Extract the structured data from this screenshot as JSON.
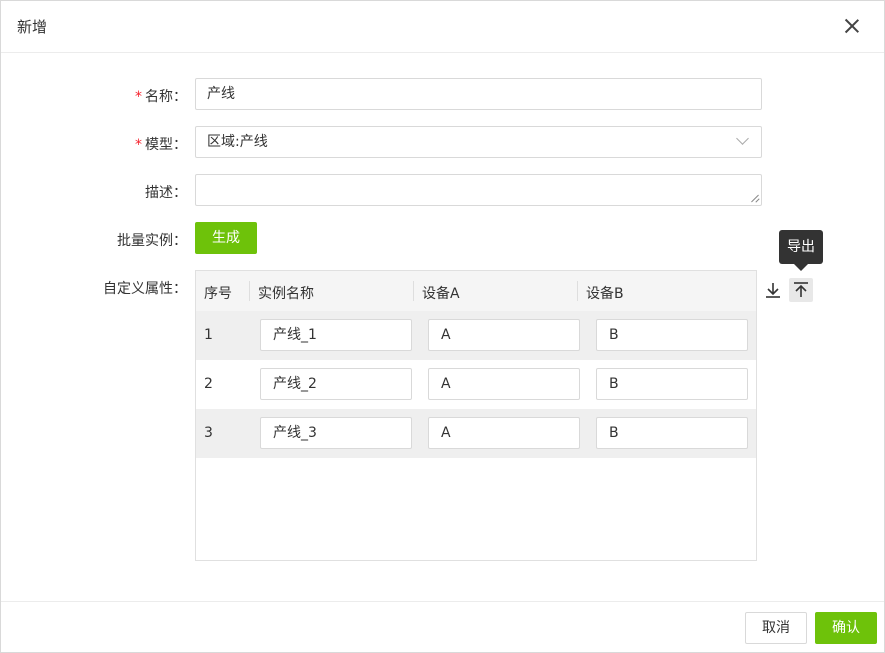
{
  "dialog": {
    "title": "新增"
  },
  "form": {
    "name": {
      "label": "名称：",
      "value": "产线"
    },
    "model": {
      "label": "模型：",
      "value": "区域:产线"
    },
    "desc": {
      "label": "描述：",
      "value": ""
    },
    "batch": {
      "label": "批量实例：",
      "button": "生成"
    },
    "custom": {
      "label": "自定义属性："
    }
  },
  "table": {
    "headers": [
      "序号",
      "实例名称",
      "设备A",
      "设备B"
    ],
    "rows": [
      {
        "index": "1",
        "name": "产线_1",
        "a": "A",
        "b": "B"
      },
      {
        "index": "2",
        "name": "产线_2",
        "a": "A",
        "b": "B"
      },
      {
        "index": "3",
        "name": "产线_3",
        "a": "A",
        "b": "B"
      }
    ]
  },
  "actions": {
    "import_icon": "download-icon",
    "export_icon": "upload-icon",
    "tooltip": "导出"
  },
  "footer": {
    "cancel": "取消",
    "ok": "确认"
  },
  "colors": {
    "primary": "#6ec20a",
    "required": "#f5222d",
    "tooltip_bg": "#333333"
  }
}
